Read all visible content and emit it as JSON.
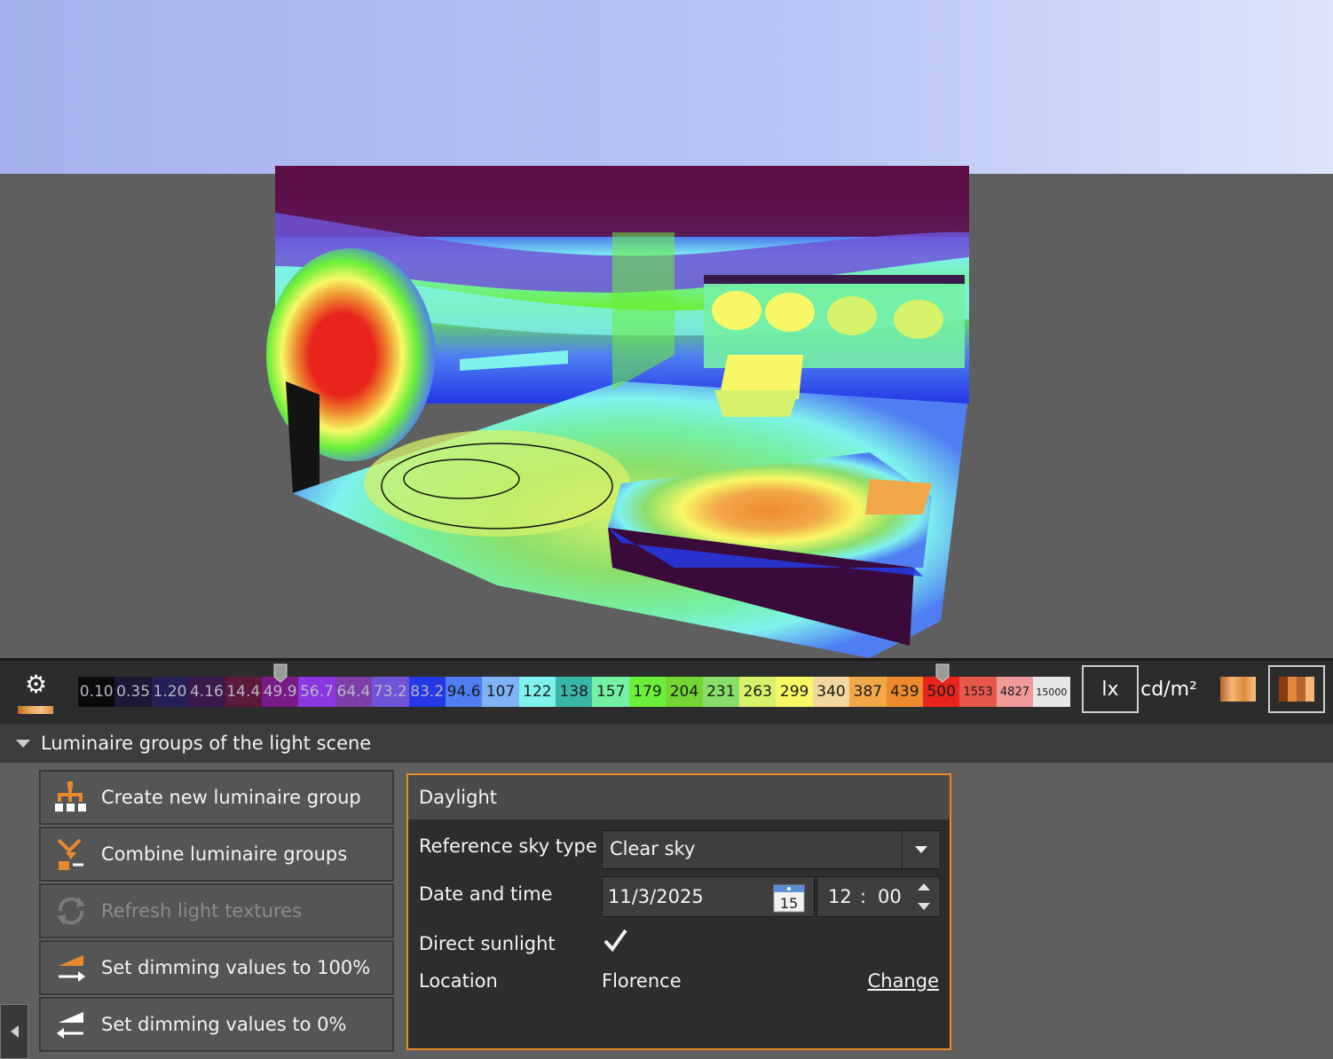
{
  "viewport": {
    "sky_color": "#b7c2f3",
    "ground_color": "#5f5f5f"
  },
  "scale_bar": {
    "values": [
      "0.10",
      "0.35",
      "1.20",
      "4.16",
      "14.4",
      "49.9",
      "56.7",
      "64.4",
      "73.2",
      "83.2",
      "94.6",
      "107",
      "122",
      "138",
      "157",
      "179",
      "204",
      "231",
      "263",
      "299",
      "340",
      "387",
      "439",
      "500",
      "1553",
      "4827",
      "15000"
    ],
    "colors": [
      "#0a0a0a",
      "#1c1836",
      "#251f57",
      "#3a1a4a",
      "#5c1a3c",
      "#7a1a86",
      "#8b36e0",
      "#7c3fa8",
      "#6f54d8",
      "#2438e6",
      "#4f7ef2",
      "#7fb2f6",
      "#7ff2ee",
      "#3ab6a6",
      "#74f0a4",
      "#6af03a",
      "#74d634",
      "#8ade6a",
      "#d6f26a",
      "#f8f866",
      "#f3d7a0",
      "#f2a848",
      "#ee8a2e",
      "#e8241c",
      "#e8584a",
      "#f09a9a",
      "#e6e6e6"
    ],
    "low_handle_value": "49.9",
    "high_handle_value": "500",
    "units": {
      "lux": "lx",
      "luminance": "cd/m²"
    },
    "active_unit": "lx"
  },
  "panel": {
    "title": "Luminaire groups of the light scene",
    "actions": [
      {
        "label": "Create new luminaire group",
        "icon": "hierarchy-icon",
        "enabled": true
      },
      {
        "label": "Combine luminaire groups",
        "icon": "combine-icon",
        "enabled": true
      },
      {
        "label": "Refresh light textures",
        "icon": "refresh-icon",
        "enabled": false
      },
      {
        "label": "Set dimming values to 100%",
        "icon": "dim-up-icon",
        "enabled": true
      },
      {
        "label": "Set dimming values to 0%",
        "icon": "dim-down-icon",
        "enabled": true
      }
    ]
  },
  "daylight": {
    "title": "Daylight",
    "sky_type_label": "Reference sky type",
    "sky_type_value": "Clear sky",
    "date_label": "Date and time",
    "date_value": "11/3/2025",
    "calendar_day": "15",
    "time_hour": "12",
    "time_sep": ":",
    "time_minute": "00",
    "sunlight_label": "Direct sunlight",
    "sunlight_checked": true,
    "location_label": "Location",
    "location_value": "Florence",
    "change_label": "Change",
    "accent_color": "#e8892c"
  }
}
